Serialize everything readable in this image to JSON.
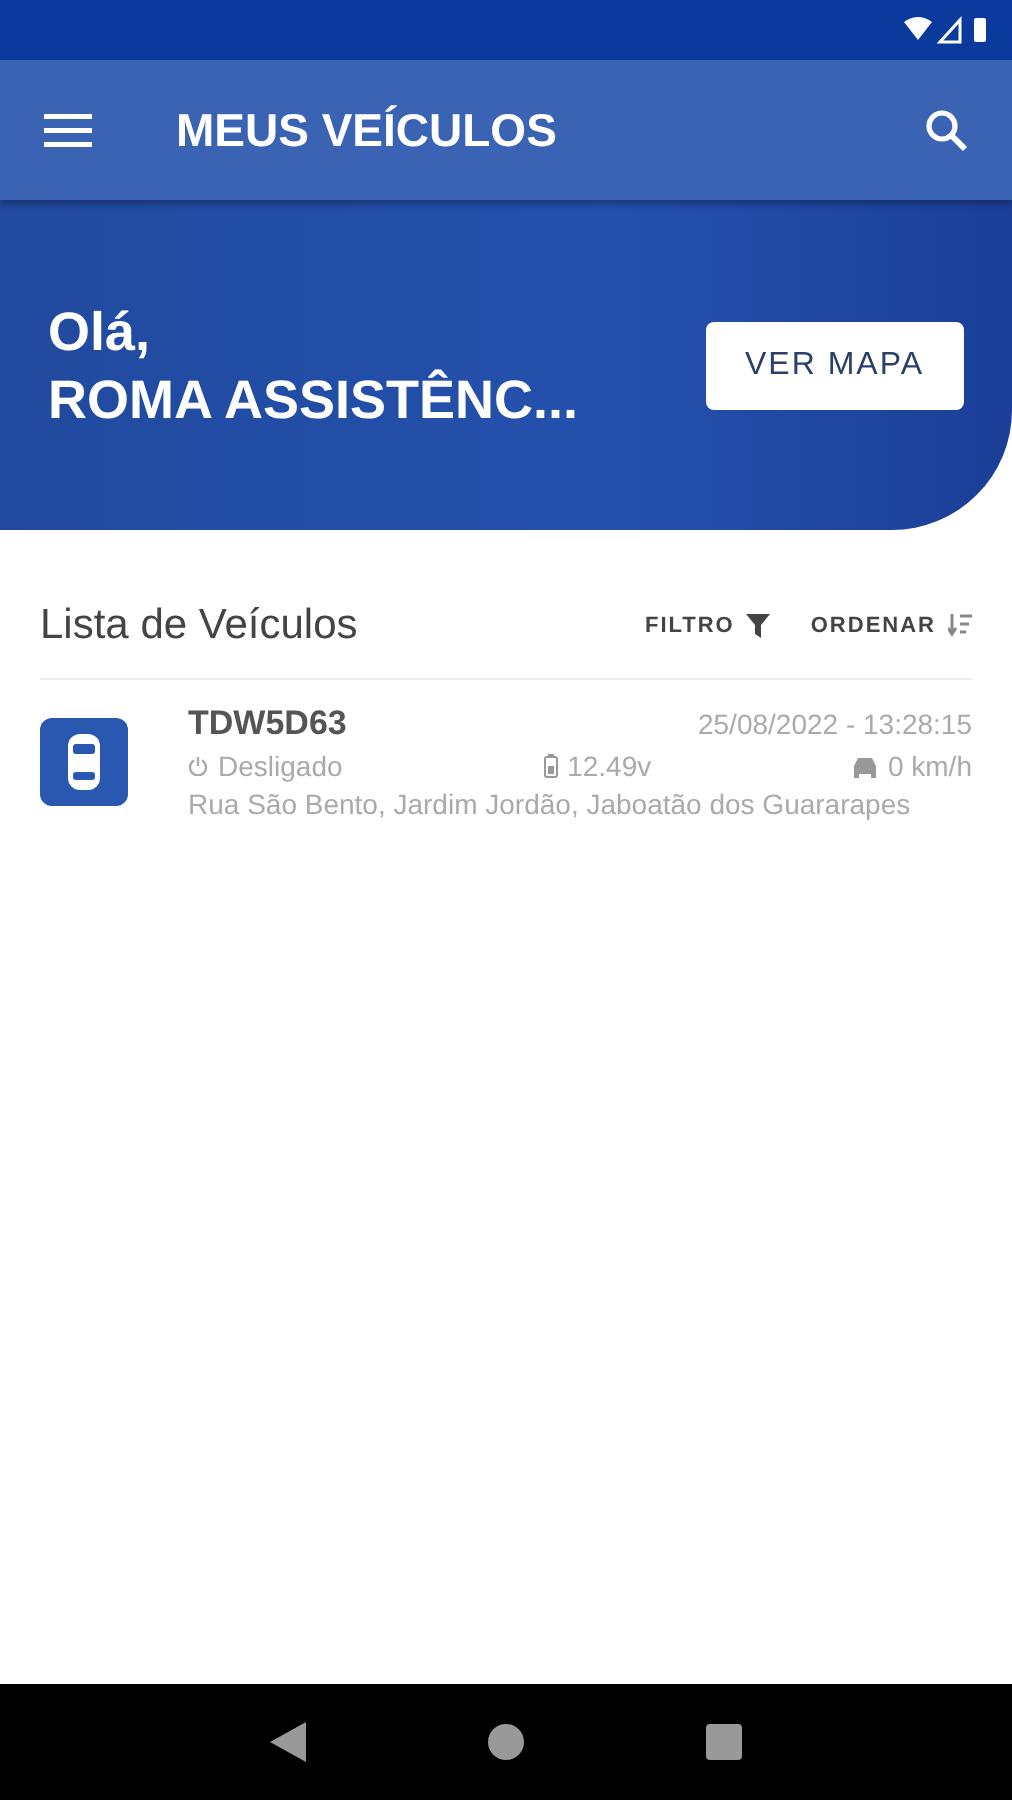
{
  "app_bar": {
    "title": "MEUS VEÍCULOS"
  },
  "greeting": {
    "line_1": "Olá,",
    "line_2": "ROMA ASSISTÊNC...",
    "button": "VER MAPA"
  },
  "list": {
    "title": "Lista de Veículos",
    "filter": "FILTRO",
    "sort": "ORDENAR"
  },
  "vehicles": [
    {
      "plate": "TDW5D63",
      "datetime": "25/08/2022 - 13:28:15",
      "status": "Desligado",
      "voltage": "12.49v",
      "speed": "0 km/h",
      "address": "Rua São Bento, Jardim Jordão, Jaboatão dos Guararapes"
    }
  ]
}
